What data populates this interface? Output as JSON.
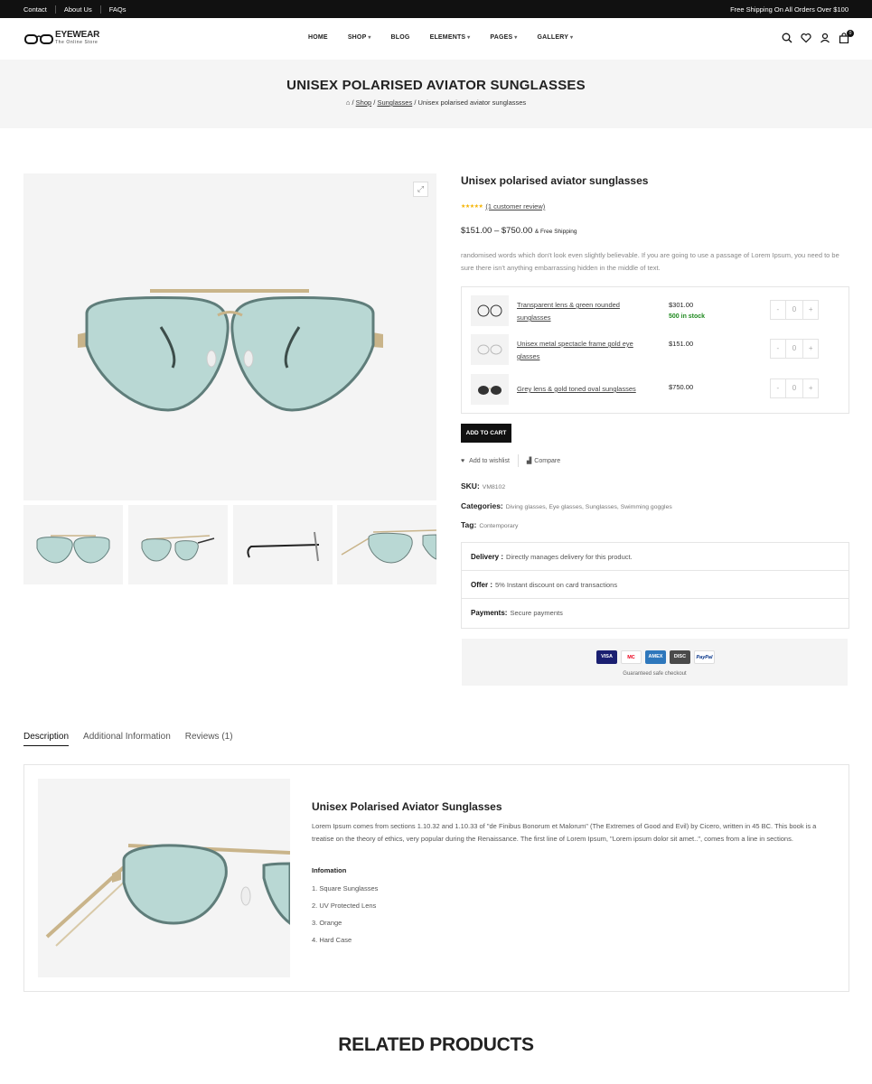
{
  "topbar": {
    "links": [
      "Contact",
      "About Us",
      "FAQs"
    ],
    "shipping": "Free Shipping On All Orders Over $100"
  },
  "logo": {
    "title": "EYEWEAR",
    "tagline": "The Online Store"
  },
  "nav": [
    "HOME",
    "SHOP",
    "BLOG",
    "ELEMENTS",
    "PAGES",
    "GALLERY"
  ],
  "header": {
    "cart_count": "0"
  },
  "page": {
    "title": "UNISEX POLARISED AVIATOR SUNGLASSES",
    "breadcrumb": {
      "home": "⌂",
      "sep": "/",
      "shop": "Shop",
      "category": "Sunglasses",
      "current": "Unisex polarised aviator sunglasses"
    }
  },
  "product": {
    "name": "Unisex polarised aviator sunglasses",
    "stars": "★★★★★",
    "rating_value": 5,
    "review_link": "(1 customer review)",
    "price": "$151.00 – $750.00",
    "shipping_note": "& Free Shipping",
    "short_description": "randomised words which don't look even slightly believable. If you are going to use a passage of Lorem Ipsum, you need to be sure there isn't anything embarrassing hidden in the middle of text.",
    "grouped": [
      {
        "name": "Transparent lens & green rounded sunglasses",
        "price": "$301.00",
        "stock": "500 in stock",
        "qty": "0",
        "minus": "-",
        "plus": "+"
      },
      {
        "name": "Unisex metal spectacle frame gold eye glasses",
        "price": "$151.00",
        "stock": "",
        "qty": "0",
        "minus": "-",
        "plus": "+"
      },
      {
        "name": "Grey lens & gold toned oval sunglasses",
        "price": "$750.00",
        "stock": "",
        "qty": "0",
        "minus": "-",
        "plus": "+"
      }
    ],
    "add_to_cart": "ADD TO CART",
    "wishlist": "Add to wishlist",
    "compare": "Compare",
    "sku_label": "SKU:",
    "sku": "VM8102",
    "categories_label": "Categories:",
    "categories": "Diving glasses, Eye glasses, Sunglasses, Swimming goggles",
    "tag_label": "Tag:",
    "tag": "Contemporary",
    "info": [
      {
        "label": "Delivery :",
        "value": "Directly manages delivery for this product."
      },
      {
        "label": "Offer :",
        "value": "5% Instant discount on card transactions"
      },
      {
        "label": "Payments:",
        "value": "Secure payments"
      }
    ],
    "payment_cards": [
      "VISA",
      "MC",
      "AMEX",
      "DISC",
      "PayPal"
    ],
    "safe_checkout": "Guaranteed safe checkout"
  },
  "tabs": [
    "Description",
    "Additional Information",
    "Reviews (1)"
  ],
  "description": {
    "title": "Unisex Polarised Aviator Sunglasses",
    "text": "Lorem Ipsum comes from sections 1.10.32 and 1.10.33 of \"de Finibus Bonorum et Malorum\" (The Extremes of Good and Evil) by Cicero, written in 45 BC. This book is a treatise on the theory of ethics, very popular during the Renaissance. The first line of Lorem Ipsum, \"Lorem ipsum dolor sit amet..\", comes from a line in sections.",
    "subtitle": "Infomation",
    "items": [
      "1. Square Sunglasses",
      "2. UV Protected Lens",
      "3. Orange",
      "4. Hard Case"
    ]
  },
  "related_title": "RELATED PRODUCTS",
  "colors": {
    "topbar": "#111111",
    "lens": "#b9d8d4",
    "frame": "#c9b48a",
    "stock_green": "#1f8a1f",
    "star": "#f5b301"
  },
  "icons": [
    "search-icon",
    "heart-icon",
    "user-icon",
    "bag-icon",
    "expand-icon",
    "heart-icon",
    "compare-icon"
  ]
}
